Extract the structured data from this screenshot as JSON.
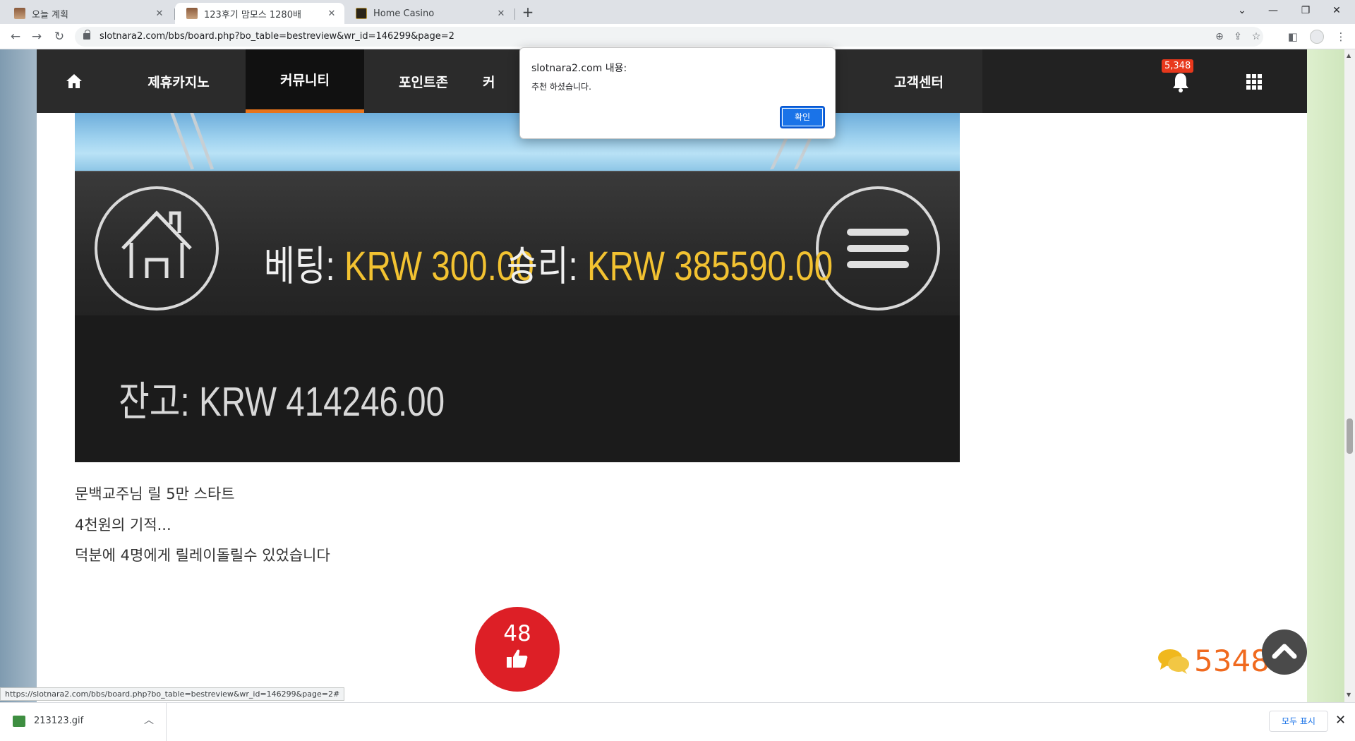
{
  "browser": {
    "tabs": [
      {
        "title": "오늘 계획",
        "active": false
      },
      {
        "title": "123후기 맘모스 1280배",
        "active": true
      },
      {
        "title": "Home Casino",
        "active": false
      }
    ],
    "url": "slotnara2.com/bbs/board.php?bo_table=bestreview&wr_id=146299&page=2",
    "status_url": "https://slotnara2.com/bbs/board.php?bo_table=bestreview&wr_id=146299&page=2#",
    "icons": [
      "back-icon",
      "forward-icon",
      "reload-icon",
      "lock-icon",
      "zoom-icon",
      "share-icon",
      "star-icon",
      "sidepanel-icon",
      "profile-icon",
      "menu-icon"
    ]
  },
  "site_nav": {
    "items": [
      "제휴카지노",
      "커뮤니티",
      "포인트존",
      "고객센터"
    ],
    "partial_item": "커",
    "active_item": "커뮤니티",
    "notification_count": "5,348",
    "accent_color": "#e8741c"
  },
  "game": {
    "bet_label": "베팅:",
    "bet_value": "KRW 300.00",
    "win_label": "승리:",
    "win_value": "KRW 385590.00",
    "balance_label": "잔고:",
    "balance_value": "KRW 414246.00"
  },
  "post": {
    "lines": [
      "문백교주님 릴 5만 스타트",
      "4천원의 기적...",
      "덕분에 4명에게 릴레이돌릴수 있었습니다"
    ],
    "recommend_count": "48",
    "comment_count": "5348"
  },
  "alert": {
    "title": "slotnara2.com 내용:",
    "message": "추천 하셨습니다.",
    "ok_label": "확인"
  },
  "downloads": {
    "file_name": "213123.gif",
    "show_all_label": "모두 표시"
  }
}
